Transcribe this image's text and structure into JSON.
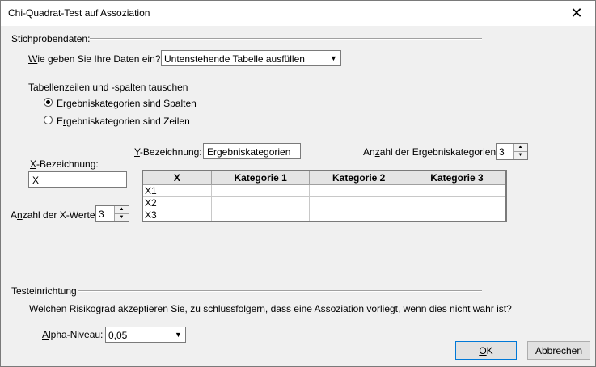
{
  "window": {
    "title": "Chi-Quadrat-Test auf Assoziation"
  },
  "sample": {
    "section_title": "Stichprobendaten:",
    "input_method_label_u": "W",
    "input_method_label_rest": "ie geben Sie Ihre Daten ein?",
    "input_method_value": "Untenstehende Tabelle ausfüllen",
    "swap_label": "Tabellenzeilen und -spalten tauschen",
    "radio_columns_pre": "Ergeb",
    "radio_columns_u": "n",
    "radio_columns_post": "iskategorien sind Spalten",
    "radio_columns_checked": true,
    "radio_rows_pre": "E",
    "radio_rows_u": "r",
    "radio_rows_post": "gebniskategorien sind Zeilen",
    "radio_rows_checked": false,
    "y_label_u": "Y",
    "y_label_rest": "-Bezeichnung:",
    "y_value": "Ergebniskategorien",
    "categories_count_label_pre": "An",
    "categories_count_label_u": "z",
    "categories_count_label_post": "ahl der Ergebniskategorien:",
    "categories_count_value": "3",
    "x_label_u": "X",
    "x_label_rest": "-Bezeichnung:",
    "x_value": "X",
    "x_count_label_pre": "A",
    "x_count_label_u": "n",
    "x_count_label_post": "zahl der X-Werte:",
    "x_count_value": "3"
  },
  "table": {
    "headers": [
      "X",
      "Kategorie 1",
      "Kategorie 2",
      "Kategorie 3"
    ],
    "rows": [
      [
        "X1",
        "",
        "",
        ""
      ],
      [
        "X2",
        "",
        "",
        ""
      ],
      [
        "X3",
        "",
        "",
        ""
      ]
    ]
  },
  "test": {
    "section_title": "Testeinrichtung",
    "question": "Welchen Risikograd akzeptieren Sie, zu schlussfolgern, dass eine Assoziation vorliegt, wenn dies nicht wahr ist?",
    "alpha_label_u": "A",
    "alpha_label_rest": "lpha-Niveau:",
    "alpha_value": "0,05"
  },
  "buttons": {
    "ok_u": "O",
    "ok_rest": "K",
    "cancel": "Abbrechen"
  }
}
